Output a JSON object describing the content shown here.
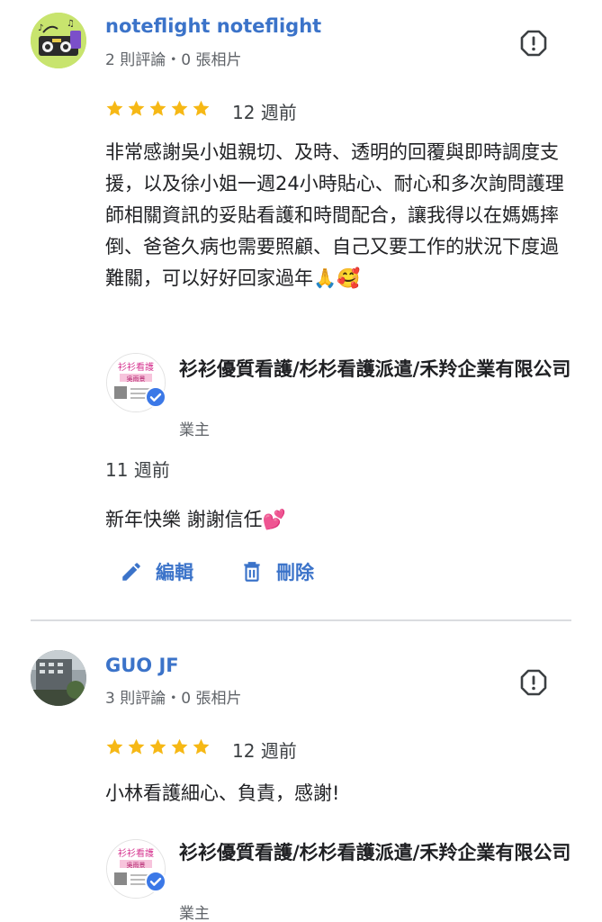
{
  "reviews": [
    {
      "reviewer_name": "noteflight noteflight",
      "reviewer_meta": "2 則評論・0 張相片",
      "rating": 5,
      "time": "12 週前",
      "text": "非常感謝吳小姐親切、及時、透明的回覆與即時調度支援，以及徐小姐一週24小時貼心、耐心和多次詢問護理師相關資訊的妥貼看護和時間配合，讓我得以在媽媽摔倒、爸爸久病也需要照顧、自己又要工作的狀況下度過難關，可以好好回家過年🙏🥰",
      "owner_name": "衫衫優質看護/杉杉看護派遣/禾羚企業有限公司",
      "owner_role": "業主",
      "reply_time": "11 週前",
      "reply_text": "新年快樂 謝謝信任💕",
      "edit_label": "編輯",
      "delete_label": "刪除"
    },
    {
      "reviewer_name": "GUO JF",
      "reviewer_meta": "3 則評論・0 張相片",
      "rating": 5,
      "time": "12 週前",
      "text": "小林看護細心、負責，感謝!",
      "owner_name": "衫衫優質看護/杉杉看護派遣/禾羚企業有限公司",
      "owner_role": "業主"
    }
  ],
  "owner_logo_text": "衫衫看護",
  "owner_logo_subtext": "吳雨景",
  "colors": {
    "accent": "#3b73c9",
    "star": "#f6b815",
    "text_secondary": "#5f6368"
  },
  "icons": [
    "report-flag-icon",
    "star-icon",
    "pencil-icon",
    "trash-icon",
    "verified-check-icon"
  ]
}
